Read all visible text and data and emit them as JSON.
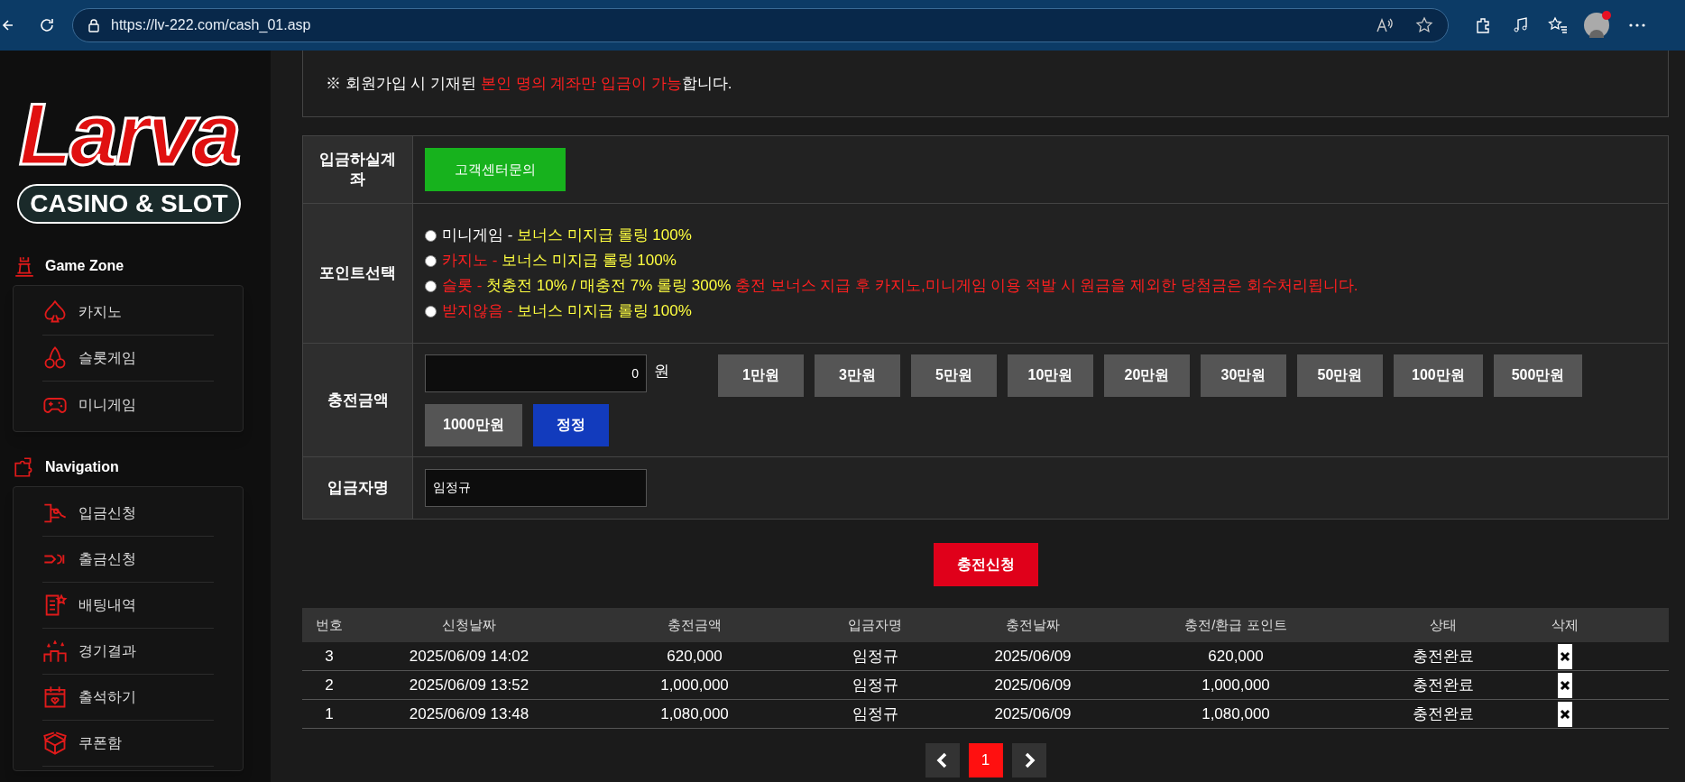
{
  "browser": {
    "url": "https://lv-222.com/cash_01.asp"
  },
  "sidebar": {
    "logo": {
      "title": "Larva",
      "subtitle": "CASINO & SLOT"
    },
    "sections": [
      {
        "title": "Game Zone",
        "items": [
          {
            "label": "카지노"
          },
          {
            "label": "슬롯게임"
          },
          {
            "label": "미니게임"
          }
        ]
      },
      {
        "title": "Navigation",
        "items": [
          {
            "label": "입금신청"
          },
          {
            "label": "출금신청"
          },
          {
            "label": "배팅내역"
          },
          {
            "label": "경기결과"
          },
          {
            "label": "출석하기"
          },
          {
            "label": "쿠폰함"
          }
        ]
      }
    ]
  },
  "notice": [
    {
      "text": "※ 회원가입 시 기재된 ",
      "color": "#ffffff"
    },
    {
      "text": "본인 명의 계좌만 입금이 가능",
      "color": "#ff2020"
    },
    {
      "text": "합니다.",
      "color": "#ffffff"
    }
  ],
  "form": {
    "account": {
      "label": "입금하실계좌",
      "button": "고객센터문의"
    },
    "points": {
      "label": "포인트선택",
      "options": [
        {
          "selected": false,
          "parts": [
            {
              "text": "미니게임 -",
              "color": "#ffffff"
            },
            {
              "text": " 보너스 미지급 롤링 100%",
              "color": "#ffff40"
            }
          ]
        },
        {
          "selected": false,
          "parts": [
            {
              "text": "카지노 -",
              "color": "#ff2020"
            },
            {
              "text": " 보너스 미지급 롤링 100%",
              "color": "#ffff40"
            }
          ]
        },
        {
          "selected": false,
          "parts": [
            {
              "text": "슬롯 -",
              "color": "#ff2020"
            },
            {
              "text": " 첫충전 10% / 매충전 7% 롤링 300%",
              "color": "#ffff40"
            },
            {
              "text": " 충전 보너스 지급 후 카지노,미니게임 이용 적발 시 원금을 제외한 당첨금은 회수처리됩니다.",
              "color": "#ff2020"
            }
          ]
        },
        {
          "selected": false,
          "parts": [
            {
              "text": "받지않음 -",
              "color": "#ff2020"
            },
            {
              "text": " 보너스 미지급 롤링 100%",
              "color": "#ffff40"
            }
          ]
        }
      ]
    },
    "amount": {
      "label": "충전금액",
      "value": "0",
      "unit": "원",
      "presets": [
        "1만원",
        "3만원",
        "5만원",
        "10만원",
        "20만원",
        "30만원",
        "50만원",
        "100만원",
        "500만원",
        "1000만원"
      ],
      "reset": "정정"
    },
    "depositor": {
      "label": "입금자명",
      "value": "임정규"
    }
  },
  "submit": "충전신청",
  "table": {
    "columns": [
      "번호",
      "신청날짜",
      "충전금액",
      "입금자명",
      "충전날짜",
      "충전/환급 포인트",
      "상태",
      "삭제"
    ],
    "rows": [
      [
        "3",
        "2025/06/09 14:02",
        "620,000",
        "임정규",
        "2025/06/09",
        "620,000",
        "충전완료"
      ],
      [
        "2",
        "2025/06/09 13:52",
        "1,000,000",
        "임정규",
        "2025/06/09",
        "1,000,000",
        "충전완료"
      ],
      [
        "1",
        "2025/06/09 13:48",
        "1,080,000",
        "임정규",
        "2025/06/09",
        "1,080,000",
        "충전완료"
      ]
    ]
  },
  "pagination": {
    "pages": [
      {
        "label": "1",
        "selected": true
      }
    ]
  }
}
